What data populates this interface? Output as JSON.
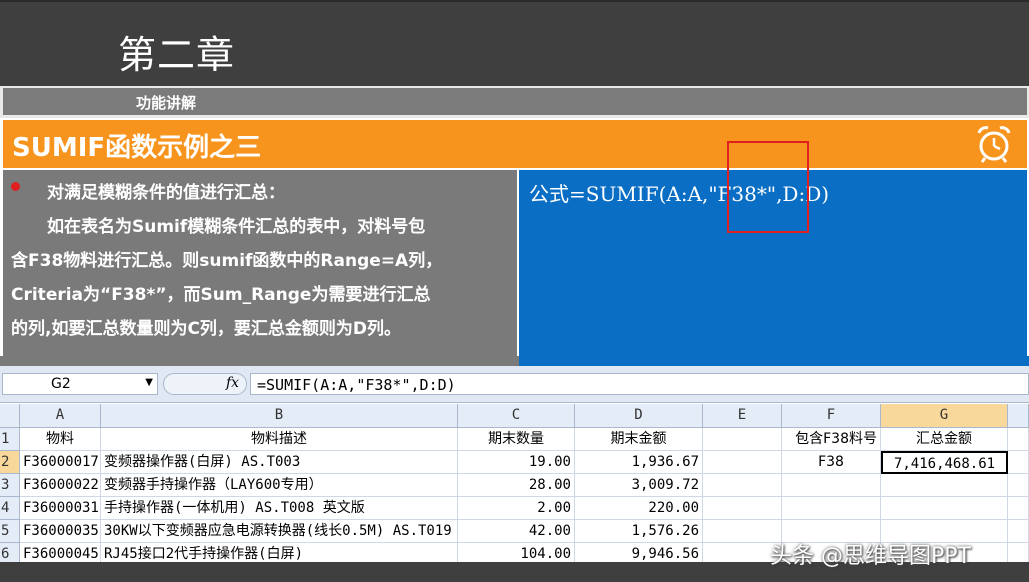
{
  "slide": {
    "chapter": "第二章",
    "subtitle": "功能讲解",
    "title": "SUMIF函数示例之三",
    "left_lines": [
      "对满足模糊条件的值进行汇总：",
      "如在表名为Sumif模糊条件汇总的表中，对料号包",
      "含F38物料进行汇总。则sumif函数中的Range=A列，",
      "Criteria为“F38*”，而Sum_Range为需要进行汇总",
      "的列,如要汇总数量则为C列，要汇总金额则为D列。"
    ],
    "formula_text": "公式=SUMIF(A:A,\"F38*\",D:D)"
  },
  "excel": {
    "name_box": "G2",
    "fx_label": "fx",
    "formula": "=SUMIF(A:A,\"F38*\",D:D)",
    "columns": [
      "A",
      "B",
      "C",
      "D",
      "E",
      "F",
      "G"
    ],
    "rows": [
      {
        "num": "1",
        "A": "物料",
        "B": "物料描述",
        "C": "期末数量",
        "D": "期末金额",
        "E": "",
        "F": "包含F38料号",
        "G": "汇总金额"
      },
      {
        "num": "2",
        "A": "F36000017",
        "B": "变频器操作器(白屏) AS.T003",
        "C": "19.00",
        "D": "1,936.67",
        "E": "",
        "F": "F38",
        "G": "7,416,468.61"
      },
      {
        "num": "3",
        "A": "F36000022",
        "B": "变频器手持操作器（LAY600专用）",
        "C": "28.00",
        "D": "3,009.72",
        "E": "",
        "F": "",
        "G": ""
      },
      {
        "num": "4",
        "A": "F36000031",
        "B": "手持操作器(一体机用) AS.T008  英文版",
        "C": "2.00",
        "D": "220.00",
        "E": "",
        "F": "",
        "G": ""
      },
      {
        "num": "5",
        "A": "F36000035",
        "B": "30KW以下变频器应急电源转换器(线长0.5M)  AS.T019",
        "C": "42.00",
        "D": "1,576.26",
        "E": "",
        "F": "",
        "G": ""
      },
      {
        "num": "6",
        "A": "F36000045",
        "B": "RJ45接口2代手持操作器(白屏)",
        "C": "104.00",
        "D": "9,946.56",
        "E": "",
        "F": "",
        "G": ""
      }
    ]
  },
  "watermark": "头条 @思维导图PPT",
  "colors": {
    "orange": "#f7941d",
    "blue": "#0a6ec4",
    "gray": "#7a7a7a",
    "dark": "#3f3f3f",
    "red": "#e02020"
  }
}
